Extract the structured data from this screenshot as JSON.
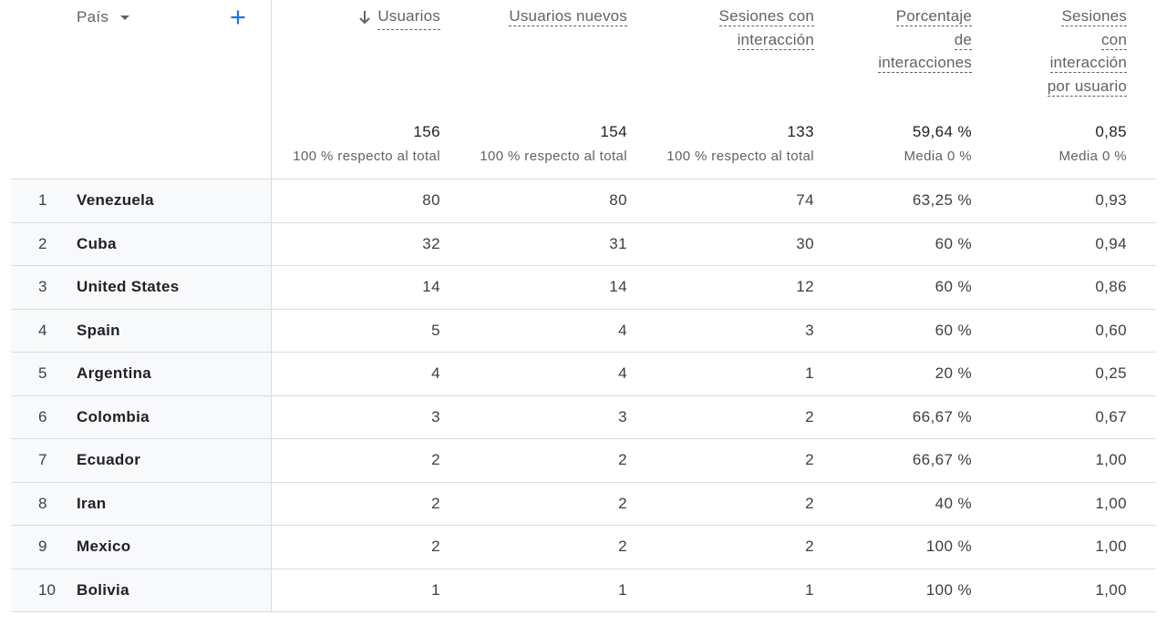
{
  "dimension": {
    "label": "País"
  },
  "metrics": [
    {
      "key": "usuarios",
      "lines": [
        "Usuarios"
      ],
      "sorted": true,
      "total": "156",
      "total_sub": "100 % respecto al total"
    },
    {
      "key": "usuarios_nuevos",
      "lines": [
        "Usuarios nuevos"
      ],
      "sorted": false,
      "total": "154",
      "total_sub": "100 % respecto al total"
    },
    {
      "key": "sesiones_interaccion",
      "lines": [
        "Sesiones con",
        "interacción"
      ],
      "sorted": false,
      "total": "133",
      "total_sub": "100 % respecto al total"
    },
    {
      "key": "porcentaje_interacciones",
      "lines": [
        "Porcentaje",
        "de",
        "interacciones"
      ],
      "sorted": false,
      "total": "59,64 %",
      "total_sub": "Media 0 %"
    },
    {
      "key": "sesiones_por_usuario",
      "lines": [
        "Sesiones",
        "con",
        "interacción",
        "por usuario"
      ],
      "sorted": false,
      "total": "0,85",
      "total_sub": "Media 0 %"
    }
  ],
  "rows": [
    {
      "index": "1",
      "country": "Venezuela",
      "values": [
        "80",
        "80",
        "74",
        "63,25 %",
        "0,93"
      ]
    },
    {
      "index": "2",
      "country": "Cuba",
      "values": [
        "32",
        "31",
        "30",
        "60 %",
        "0,94"
      ]
    },
    {
      "index": "3",
      "country": "United States",
      "values": [
        "14",
        "14",
        "12",
        "60 %",
        "0,86"
      ]
    },
    {
      "index": "4",
      "country": "Spain",
      "values": [
        "5",
        "4",
        "3",
        "60 %",
        "0,60"
      ]
    },
    {
      "index": "5",
      "country": "Argentina",
      "values": [
        "4",
        "4",
        "1",
        "20 %",
        "0,25"
      ]
    },
    {
      "index": "6",
      "country": "Colombia",
      "values": [
        "3",
        "3",
        "2",
        "66,67 %",
        "0,67"
      ]
    },
    {
      "index": "7",
      "country": "Ecuador",
      "values": [
        "2",
        "2",
        "2",
        "66,67 %",
        "1,00"
      ]
    },
    {
      "index": "8",
      "country": "Iran",
      "values": [
        "2",
        "2",
        "2",
        "40 %",
        "1,00"
      ]
    },
    {
      "index": "9",
      "country": "Mexico",
      "values": [
        "2",
        "2",
        "2",
        "100 %",
        "1,00"
      ]
    },
    {
      "index": "10",
      "country": "Bolivia",
      "values": [
        "1",
        "1",
        "1",
        "100 %",
        "1,00"
      ]
    }
  ],
  "colors": {
    "accent": "#1a73e8",
    "divider": "#dadce0",
    "shade": "#f8f9fa"
  },
  "icons": {
    "sort": "arrow-down-icon",
    "add": "plus-icon",
    "dropdown": "caret-down-icon"
  }
}
